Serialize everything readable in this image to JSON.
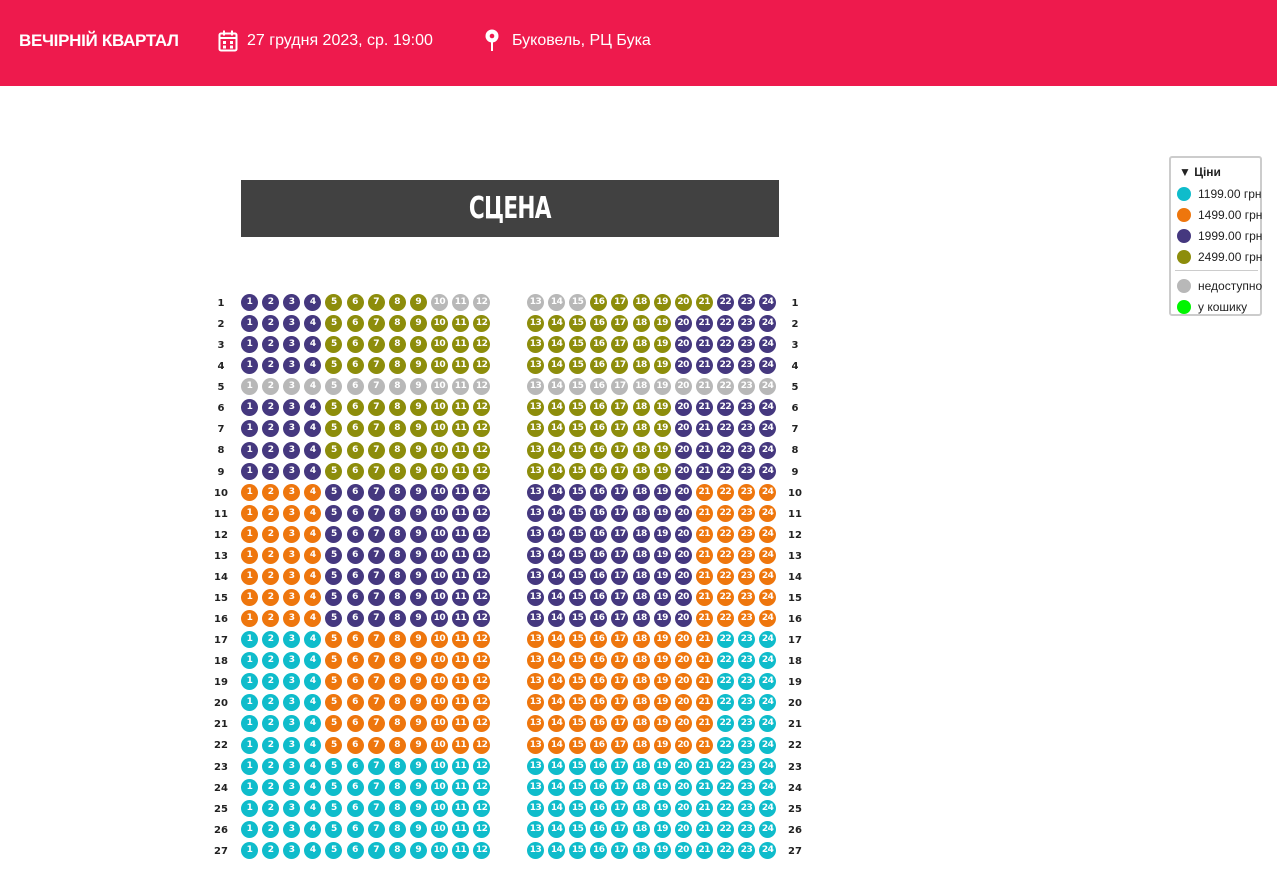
{
  "header": {
    "title": "ВЕЧІРНІЙ КВАРТАЛ",
    "date": "27 грудня 2023, ср. 19:00",
    "venue": "Буковель, РЦ Бука",
    "date_icon": "calendar-icon",
    "venue_icon": "location-pin-icon",
    "background": "#ee1a4d"
  },
  "stage": {
    "label": "СЦЕНА"
  },
  "legend": {
    "header": "▼ Ціни",
    "items": [
      {
        "label": "1199.00 грн",
        "color": "#0fbccb",
        "key": "c"
      },
      {
        "label": "1499.00 грн",
        "color": "#ee760d",
        "key": "o"
      },
      {
        "label": "1999.00 грн",
        "color": "#45387f",
        "key": "p"
      },
      {
        "label": "2499.00 грн",
        "color": "#8d8d0b",
        "key": "g"
      }
    ],
    "status": [
      {
        "label": "недоступно",
        "color": "#b8b8b8",
        "key": "u"
      },
      {
        "label": "у кошику",
        "color": "#00f500",
        "key": "b"
      }
    ]
  },
  "hall": {
    "row_numbers": [
      "1",
      "2",
      "3",
      "4",
      "5",
      "6",
      "7",
      "8",
      "9",
      "10",
      "11",
      "12",
      "13",
      "14",
      "15",
      "16",
      "17",
      "18",
      "19",
      "20",
      "21",
      "22",
      "23",
      "24",
      "25",
      "26",
      "27"
    ],
    "seats_per_row": 24,
    "left_block_last_seat": 12,
    "rows": [
      "ppppggggguuuuuuggggggpppp",
      "ppppgggggggggggggggppppp",
      "ppppgggggggggggggggppppp",
      "ppppgggggggggggggggppppp",
      "uuuuuuuuuuuuuuuuuuuuuuuu",
      "ppppgggggggggggggggppppp",
      "ppppgggggggggggggggppppp",
      "ppppgggggggggggggggppppp",
      "ppppgggggggggggggggppppp",
      "ooooppppppppppppppppoooo",
      "ooooppppppppppppppppoooo",
      "ooooppppppppppppppppoooo",
      "ooooppppppppppppppppoooo",
      "ooooppppppppppppppppoooo",
      "ooooppppppppppppppppoooo",
      "ooooppppppppppppppppoooo",
      "ccccooooooooooooooooocccc",
      "ccccooooooooooooooooocccc",
      "ccccooooooooooooooooocccc",
      "ccccooooooooooooooooocccc",
      "ccccooooooooooooooooocccc",
      "ccccooooooooooooooooocccc",
      "cccccccccccccccccccccccc",
      "cccccccccccccccccccccccc",
      "cccccccccccccccccccccccc",
      "cccccccccccccccccccccccc",
      "cccccccccccccccccccccccc"
    ]
  }
}
